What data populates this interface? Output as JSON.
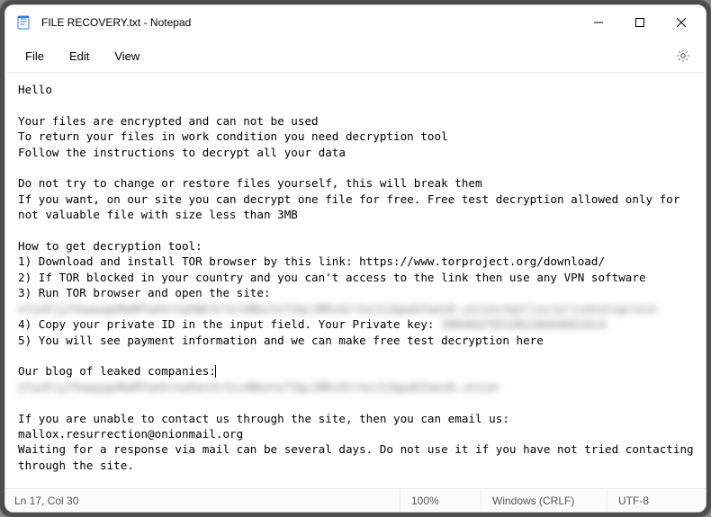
{
  "titlebar": {
    "title": "FILE RECOVERY.txt - Notepad"
  },
  "menu": {
    "file": "File",
    "edit": "Edit",
    "view": "View"
  },
  "body": {
    "l1": "Hello",
    "l2": "",
    "l3": "Your files are encrypted and can not be used",
    "l4": "To return your files in work condition you need decryption tool",
    "l5": "Follow the instructions to decrypt all your data",
    "l6": "",
    "l7": "Do not try to change or restore files yourself, this will break them",
    "l8": "If you want, on our site you can decrypt one file for free. Free test decryption allowed only for not valuable file with size less than 3MB",
    "l9": "",
    "l10": "How to get decryption tool:",
    "l11": "1) Download and install TOR browser by this link: https://www.torproject.org/download/",
    "l12": "2) If TOR blocked in your country and you can't access to the link then use any VPN software",
    "l13": "3) Run TOR browser and open the site:",
    "l14_blur": "ofyoFjyfhwaygoRwMfwehroahWchrScxNbute73qc3MhvGrtec2jbpabIaes6.onion/mallox/privatetoprein",
    "l15_a": "4) Copy your private ID in the input field. Your Private key: ",
    "l15_blur": "38046d78519b18b646619cA",
    "l16": "5) You will see payment information and we can make free test decryption here",
    "l17": "",
    "l18": "Our blog of leaked companies:",
    "l19_blur": "ofyoFjyfhwaygoRwMfwehroahechrScxNbute73qc3MhvGrtec2jbpabIaes6.onion",
    "l20": "",
    "l21": "If you are unable to contact us through the site, then you can email us: mallox.resurrection@onionmail.org",
    "l22": "Waiting for a response via mail can be several days. Do not use it if you have not tried contacting through the site."
  },
  "status": {
    "pos": "Ln 17, Col 30",
    "zoom": "100%",
    "eol": "Windows (CRLF)",
    "enc": "UTF-8"
  }
}
